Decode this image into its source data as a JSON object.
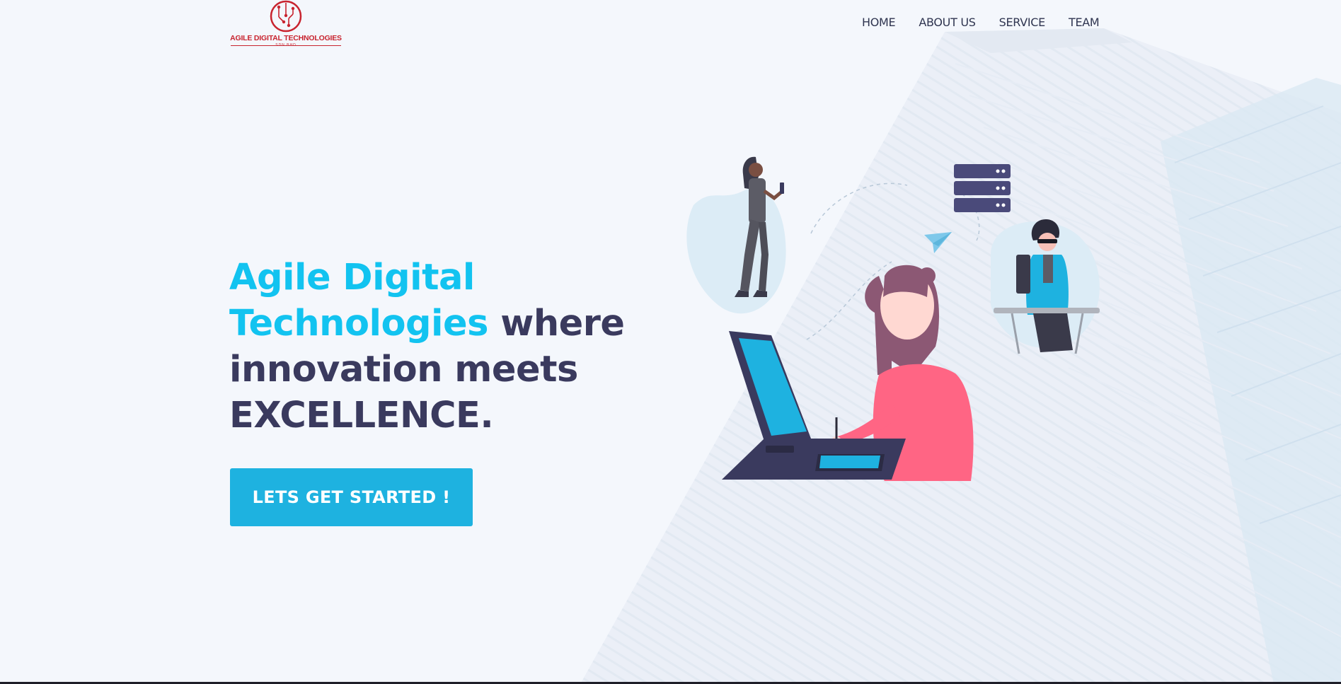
{
  "logo": {
    "name": "AGILE DIGITAL TECHNOLOGIES",
    "sub": "SDN BHD"
  },
  "nav": {
    "items": [
      {
        "label": "HOME"
      },
      {
        "label": "ABOUT US"
      },
      {
        "label": "SERVICE"
      },
      {
        "label": "TEAM"
      }
    ]
  },
  "hero": {
    "headline_accent_1": "Agile Digital",
    "headline_accent_2": "Technologies",
    "headline_rest_1": " where",
    "headline_rest_2": "innovation meets",
    "headline_rest_3": "EXCELLENCE.",
    "cta_label": "LETS GET STARTED !"
  },
  "colors": {
    "accent": "#12c3f0",
    "button": "#1eb2e0",
    "heading": "#3a3a5e",
    "logo_red": "#c8242f",
    "background": "#f4f7fc"
  }
}
